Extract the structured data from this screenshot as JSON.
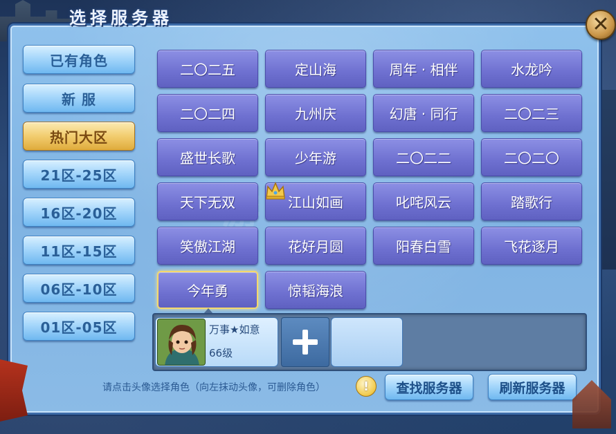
{
  "window": {
    "title": "选择服务器",
    "close_icon": "close-icon",
    "watermark": "游"
  },
  "sidebar": {
    "items": [
      {
        "label": "已有角色",
        "active": false
      },
      {
        "label": "新 服",
        "active": false
      },
      {
        "label": "热门大区",
        "active": true
      },
      {
        "label": "21区-25区",
        "active": false
      },
      {
        "label": "16区-20区",
        "active": false
      },
      {
        "label": "11区-15区",
        "active": false
      },
      {
        "label": "06区-10区",
        "active": false
      },
      {
        "label": "01区-05区",
        "active": false
      }
    ]
  },
  "servers": [
    {
      "label": "二〇二五"
    },
    {
      "label": "定山海"
    },
    {
      "label": "周年 · 相伴"
    },
    {
      "label": "水龙吟"
    },
    {
      "label": "二〇二四"
    },
    {
      "label": "九州庆"
    },
    {
      "label": "幻唐 · 同行"
    },
    {
      "label": "二〇二三"
    },
    {
      "label": "盛世长歌"
    },
    {
      "label": "少年游"
    },
    {
      "label": "二〇二二"
    },
    {
      "label": "二〇二〇"
    },
    {
      "label": "天下无双"
    },
    {
      "label": "江山如画",
      "crown": true
    },
    {
      "label": "叱咤风云"
    },
    {
      "label": "踏歌行"
    },
    {
      "label": "笑傲江湖"
    },
    {
      "label": "花好月圆"
    },
    {
      "label": "阳春白雪"
    },
    {
      "label": "飞花逐月"
    },
    {
      "label": "今年勇",
      "selected": true
    },
    {
      "label": "惊韬海浪"
    }
  ],
  "character": {
    "name": "万事★如意",
    "level": "66级"
  },
  "footer": {
    "hint": "请点击头像选择角色（向左抹动头像，可删除角色）",
    "hint_icon": "!",
    "find_server_label": "查找服务器",
    "refresh_server_label": "刷新服务器"
  },
  "colors": {
    "panel": "#8fc1ec",
    "server_button": "#6e70d0",
    "side_button": "#a6d7fb",
    "side_button_active": "#f2cd6f",
    "selected_border": "#f5d86b"
  }
}
